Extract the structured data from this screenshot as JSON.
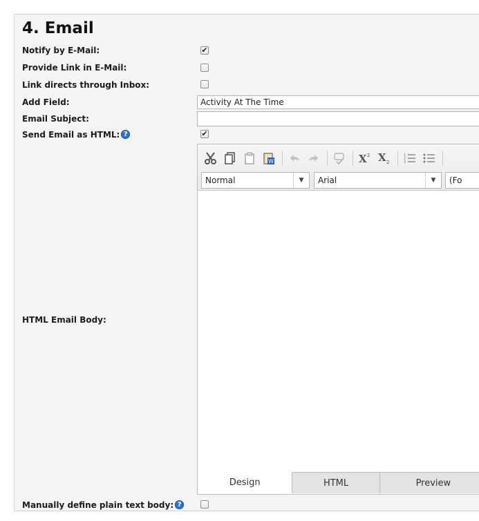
{
  "section": {
    "title": "4. Email"
  },
  "rows": {
    "notify": {
      "label": "Notify by E-Mail:",
      "checked": true
    },
    "provide_link": {
      "label": "Provide Link in E-Mail:",
      "checked": false
    },
    "link_inbox": {
      "label": "Link directs through Inbox:",
      "checked": false
    },
    "add_field": {
      "label": "Add Field:",
      "value": "Activity At The Time"
    },
    "email_subject": {
      "label": "Email Subject:",
      "value": ""
    },
    "send_html": {
      "label": "Send Email as HTML:",
      "checked": true
    },
    "html_body": {
      "label": "HTML Email Body:"
    },
    "manual_plain": {
      "label": "Manually define plain text body:",
      "checked": false
    }
  },
  "editor": {
    "format_select": "Normal",
    "font_select": "Arial",
    "size_select": "(Fo",
    "tabs": [
      "Design",
      "HTML",
      "Preview"
    ],
    "active_tab": "Design"
  },
  "glyphs": {
    "check": "✔",
    "help": "?",
    "dropdown": "▼"
  }
}
